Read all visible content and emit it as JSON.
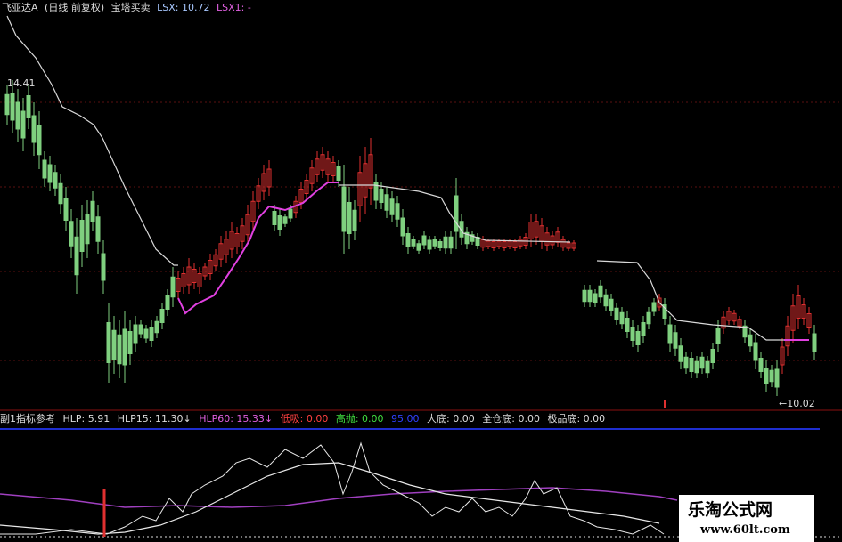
{
  "title": {
    "stock": "飞亚达A",
    "period": "(日线 前复权)",
    "indicator": "宝塔买卖",
    "lsx": "LSX: 10.72",
    "lsx1": "LSX1: -"
  },
  "price_labels": {
    "high": "14.41",
    "low": "←10.02"
  },
  "indicator_bar": {
    "name": "副1指标参考",
    "hlp": "HLP: 5.91",
    "hlp15": "HLP15: 11.30↓",
    "hlp60": "HLP60: 15.33↓",
    "dixi": "低吸: 0.00",
    "gaopao": "高抛: 0.00",
    "v95": "95.00",
    "dadi": "大底: 0.00",
    "quancangdi": "全仓底: 0.00",
    "jipindi": "极品底: 0.00"
  },
  "watermark": {
    "name": "乐淘公式网",
    "url": "www.60lt.com"
  },
  "colors": {
    "up": "#e03030",
    "down": "#7fd07f",
    "tower_line": "#d9d9d9",
    "support_line": "#e040e0",
    "purple": "#a040c0",
    "blue": "#1e2ed0",
    "white_line": "#e8e8e8"
  }
}
